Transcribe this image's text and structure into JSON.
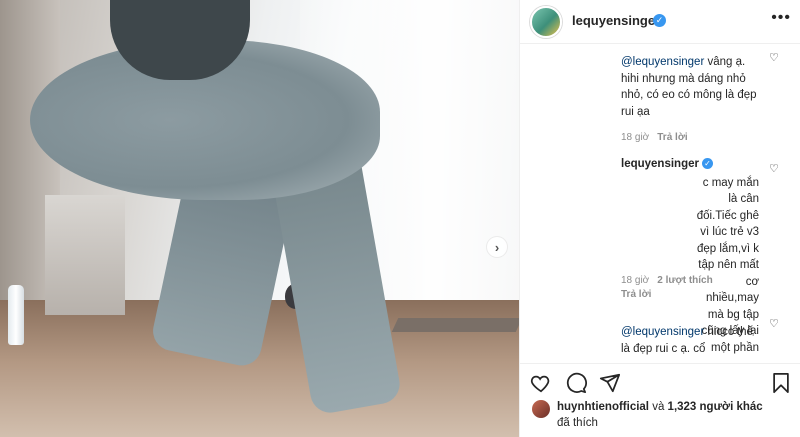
{
  "post": {
    "author": "lequyensinger",
    "verified": true,
    "more_icon": "more-horizontal-icon"
  },
  "media": {
    "next_icon": "chevron-right-icon"
  },
  "comments": [
    {
      "mention": "@lequyensinger",
      "text": " vâng ạ. hihi nhưng mà dáng nhỏ nhỏ, có eo có mông là đẹp rui ạa",
      "time": "18 giờ",
      "reply": "Trả lời"
    },
    {
      "author": "lequyensinger",
      "verified": true,
      "text": "c may mắn là cân đối.Tiếc ghê vì lúc trẻ v3 đẹp lắm,vì k tập nên mất cơ nhiều,may mà bg tập cũng lấy lại một phần",
      "time": "18 giờ",
      "likes": "2 lượt thích",
      "reply": "Trả lời"
    },
    {
      "mention": "@lequyensinger",
      "text": " hiccc thế là đẹp rui c ạ. cổ"
    }
  ],
  "actions": {
    "like_icon": "heart-icon",
    "comment_icon": "comment-icon",
    "share_icon": "share-icon",
    "save_icon": "bookmark-icon"
  },
  "likes": {
    "liker": "huynhtienofficial",
    "joiner": " và ",
    "others": "1,323 người khác",
    "suffix": "đã thích"
  },
  "colors": {
    "verified_badge": "#3897f0",
    "mention": "#00376b",
    "secondary_text": "#8e8e8e"
  }
}
